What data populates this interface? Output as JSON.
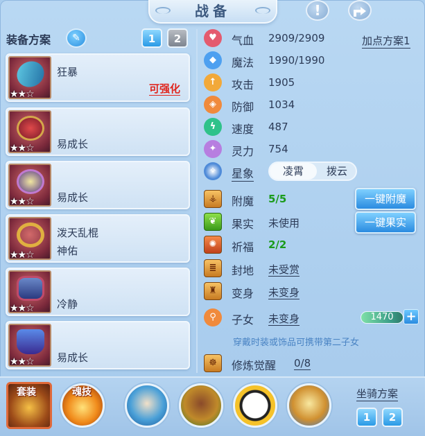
{
  "header": {
    "title": "战备",
    "help_icon": "exclamation-icon",
    "share_icon": "share-icon"
  },
  "scheme": {
    "label": "装备方案",
    "edit_icon": "pencil-icon",
    "tabs": [
      {
        "label": "1",
        "active": true
      },
      {
        "label": "2",
        "active": false
      }
    ]
  },
  "equipment": [
    {
      "name1": "狂暴",
      "name2": "",
      "enhance": "可强化",
      "stars": "★★☆",
      "icon": "staff-weapon-icon"
    },
    {
      "name1": "",
      "name2": "易成长",
      "enhance": "",
      "stars": "★★☆",
      "icon": "helmet-icon"
    },
    {
      "name1": "",
      "name2": "易成长",
      "enhance": "",
      "stars": "★★☆",
      "icon": "necklace-icon"
    },
    {
      "name1": "泼天乱棍",
      "name2": "神佑",
      "enhance": "",
      "stars": "★★☆",
      "icon": "belt-icon"
    },
    {
      "name1": "",
      "name2": "冷静",
      "enhance": "",
      "stars": "★★☆",
      "icon": "bracer-icon"
    },
    {
      "name1": "",
      "name2": "易成长",
      "enhance": "",
      "stars": "★★☆",
      "icon": "armor-icon"
    }
  ],
  "stats": [
    {
      "label": "气血",
      "value": "2909/2909",
      "icon": "heart-icon",
      "color": "#e45b6f"
    },
    {
      "label": "魔法",
      "value": "1990/1990",
      "icon": "drop-icon",
      "color": "#4ea0f0"
    },
    {
      "label": "攻击",
      "value": "1905",
      "icon": "sword-icon",
      "color": "#f2a93a"
    },
    {
      "label": "防御",
      "value": "1034",
      "icon": "shield-icon",
      "color": "#f08a3c"
    },
    {
      "label": "速度",
      "value": "487",
      "icon": "lightning-icon",
      "color": "#2fc28a"
    },
    {
      "label": "灵力",
      "value": "754",
      "icon": "spirit-icon",
      "color": "#b77ee0"
    }
  ],
  "add_point_label": "加点方案1",
  "star_sign": {
    "label": "星象",
    "icon": "star-sign-icon",
    "options": [
      "凌霄",
      "拨云"
    ],
    "selected": "凌霄"
  },
  "extras": [
    {
      "label": "附魔",
      "value": "5/5",
      "icon": "enchant-icon",
      "green": true,
      "underline": false
    },
    {
      "label": "果实",
      "value": "未使用",
      "icon": "fruit-icon",
      "green": false,
      "underline": false
    },
    {
      "label": "祈福",
      "value": "2/2",
      "icon": "blessing-icon",
      "green": true,
      "underline": false
    },
    {
      "label": "封地",
      "value": "未受赏",
      "icon": "fief-icon",
      "green": false,
      "underline": true
    },
    {
      "label": "变身",
      "value": "未变身",
      "icon": "transform-icon",
      "green": false,
      "underline": true
    },
    {
      "label": "子女",
      "value": "未变身",
      "icon": "child-icon",
      "green": false,
      "underline": true
    }
  ],
  "buttons": {
    "enchant_all": "一键附魔",
    "fruit_all": "一键果实"
  },
  "child_bar": {
    "value": "1470",
    "plus": "+"
  },
  "hint": "穿戴时装或饰品可携带第二子女",
  "cultivation": {
    "label": "修炼觉醒",
    "value": "0/8",
    "icon": "meditation-icon"
  },
  "bottom": {
    "set_label": "套装",
    "soul_label": "魂技",
    "skills": [
      "fist-skill-icon",
      "warrior-skill-icon",
      "yin-yang-skill-icon",
      "blade-skill-icon"
    ],
    "mount_label": "坐骑方案",
    "mount_tabs": [
      "1",
      "2"
    ]
  }
}
